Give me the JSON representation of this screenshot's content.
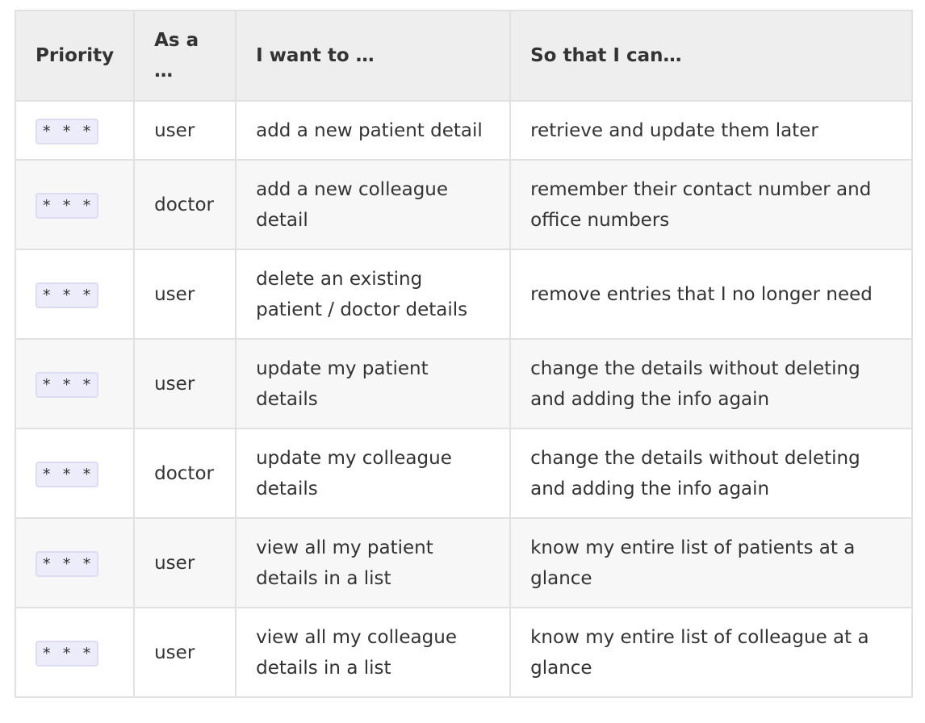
{
  "headers": {
    "priority": "Priority",
    "role": "As a …",
    "want": "I want to …",
    "so_that": "So that I can…"
  },
  "rows": [
    {
      "priority": "* * *",
      "role": "user",
      "want": "add a new patient detail",
      "so_that": "retrieve and update them later"
    },
    {
      "priority": "* * *",
      "role": "doctor",
      "want": "add a new colleague detail",
      "so_that": "remember their contact number and office numbers"
    },
    {
      "priority": "* * *",
      "role": "user",
      "want": "delete an existing patient / doctor details",
      "so_that": "remove entries that I no longer need"
    },
    {
      "priority": "* * *",
      "role": "user",
      "want": "update my patient details",
      "so_that": "change the details without deleting and adding the info again"
    },
    {
      "priority": "* * *",
      "role": "doctor",
      "want": "update my colleague details",
      "so_that": "change the details without deleting and adding the info again"
    },
    {
      "priority": "* * *",
      "role": "user",
      "want": "view all my patient details in a list",
      "so_that": "know my entire list of patients at a glance"
    },
    {
      "priority": "* * *",
      "role": "user",
      "want": "view all my colleague details in a list",
      "so_that": "know my entire list of colleague at a glance"
    }
  ]
}
